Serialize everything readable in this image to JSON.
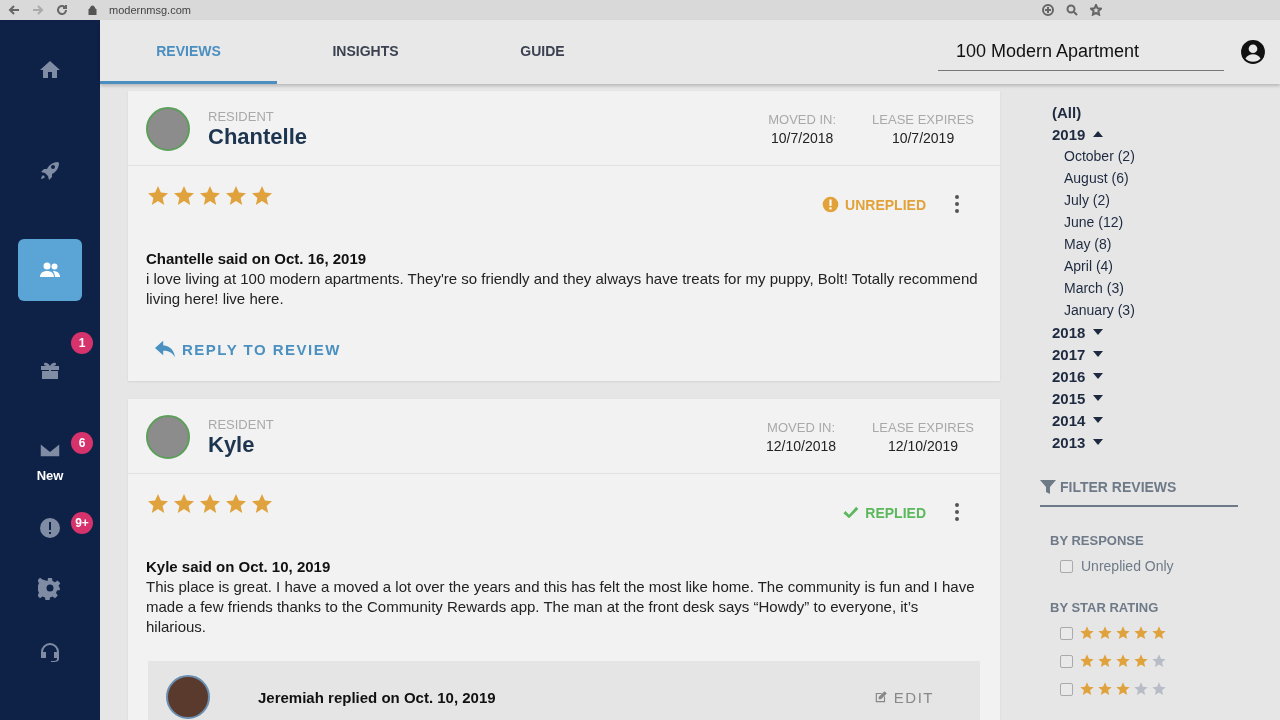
{
  "browser": {
    "url": "modernmsg.com"
  },
  "sidebar": {
    "items": [
      {
        "selected": false
      },
      {
        "selected": false
      },
      {
        "selected": true
      },
      {
        "selected": false,
        "badge": "1"
      },
      {
        "selected": false,
        "badge": "6",
        "label": "New"
      },
      {
        "selected": false,
        "badge": "9+"
      },
      {
        "selected": false
      },
      {
        "selected": false
      }
    ]
  },
  "tabs": [
    {
      "label": "REVIEWS",
      "selected": true
    },
    {
      "label": "INSIGHTS",
      "selected": false
    },
    {
      "label": "GUIDE",
      "selected": false
    }
  ],
  "property_select": {
    "value": "100 Modern Apartment"
  },
  "reviews": [
    {
      "role": "RESIDENT",
      "name": "Chantelle",
      "moved_in_label": "MOVED IN:",
      "moved_in": "10/7/2018",
      "lease_label": "LEASE EXPIRES",
      "lease_expires": "10/7/2019",
      "stars": 5,
      "status": {
        "kind": "unreplied",
        "label": "UNREPLIED"
      },
      "author_line": "Chantelle said on Oct. 16, 2019",
      "text": "i love living at 100 modern apartments. They're so friendly and they always have treats for my puppy, Bolt! Totally recommend living here! live here.",
      "reply_action": "REPLY TO REVIEW"
    },
    {
      "role": "RESIDENT",
      "name": "Kyle",
      "moved_in_label": "MOVED IN:",
      "moved_in": "12/10/2018",
      "lease_label": "LEASE EXPIRES",
      "lease_expires": "12/10/2019",
      "stars": 5,
      "status": {
        "kind": "replied",
        "label": "REPLIED"
      },
      "author_line": "Kyle said on Oct. 10, 2019",
      "text": "This place is great. I have a moved a lot over the years and this has felt the most like home. The community is fun and I have made a few friends thanks to the Community Rewards app. The man at the front desk says “Howdy” to everyone, it’s hilarious.",
      "reply": {
        "author_line": "Jeremiah replied on Oct. 10, 2019",
        "edit": "EDIT"
      }
    }
  ],
  "date_filter": [
    {
      "label": "(All)"
    },
    {
      "label": "2019",
      "expanded": true,
      "children": [
        {
          "label": "October (2)"
        },
        {
          "label": "August (6)"
        },
        {
          "label": "July (2)"
        },
        {
          "label": "June (12)"
        },
        {
          "label": "May (8)"
        },
        {
          "label": "April (4)"
        },
        {
          "label": "March (3)"
        },
        {
          "label": "January (3)"
        }
      ]
    },
    {
      "label": "2018",
      "expanded": false
    },
    {
      "label": "2017",
      "expanded": false
    },
    {
      "label": "2016",
      "expanded": false
    },
    {
      "label": "2015",
      "expanded": false
    },
    {
      "label": "2014",
      "expanded": false
    },
    {
      "label": "2013",
      "expanded": false
    }
  ],
  "filter_reviews": {
    "title": "FILTER REVIEWS",
    "by_response": {
      "heading": "BY RESPONSE",
      "options": [
        {
          "label": "Unreplied Only",
          "checked": false
        }
      ]
    },
    "by_star_rating": {
      "heading": "BY STAR RATING",
      "options": [
        {
          "stars": 5,
          "checked": false
        },
        {
          "stars": 4,
          "checked": false
        },
        {
          "stars": 3,
          "checked": false
        }
      ]
    }
  }
}
